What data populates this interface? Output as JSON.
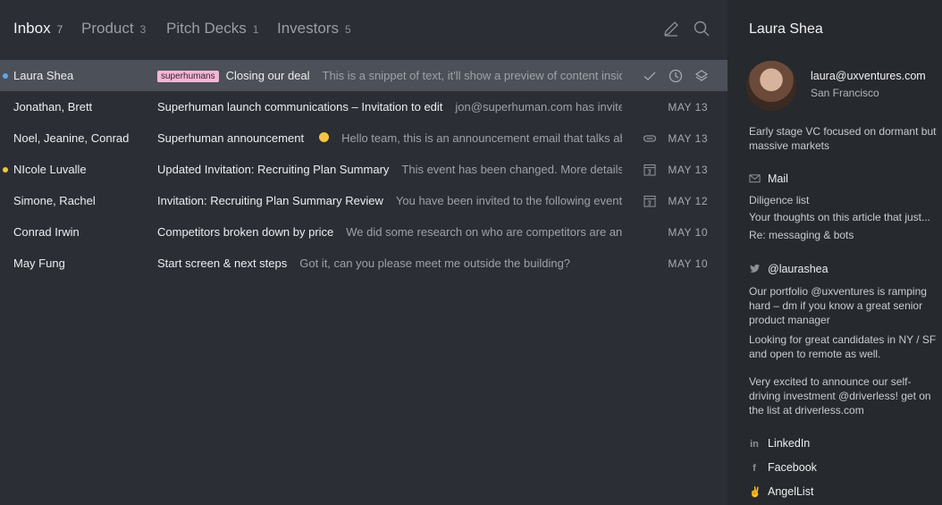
{
  "tabs": [
    {
      "label": "Inbox",
      "count": "7"
    },
    {
      "label": "Product",
      "count": "3"
    },
    {
      "label": "Pitch Decks",
      "count": "1"
    },
    {
      "label": "Investors",
      "count": "5"
    }
  ],
  "toolbar_icons": [
    "compose-icon",
    "search-icon"
  ],
  "emails": [
    {
      "sender": "Laura Shea",
      "tag": "superhumans",
      "subject": "Closing our deal",
      "snippet": "This is a snippet of text, it'll show a preview of content inside...",
      "date": "",
      "unread_color": "#5aa9e6"
    },
    {
      "sender": "Jonathan, Brett",
      "subject": "Superhuman launch communications – Invitation to edit",
      "snippet": "jon@superhuman.com has invite...",
      "date": "MAY 13"
    },
    {
      "sender": "Noel, Jeanine, Conrad",
      "subject": "Superhuman announcement",
      "snippet": "Hello team, this is an announcement email that talks about t...",
      "date": "MAY 13"
    },
    {
      "sender": "NIcole Luvalle",
      "subject": "Updated Invitation: Recruiting Plan Summary",
      "snippet": "This event has been changed. More details Rec...",
      "date": "MAY 13",
      "unread_color": "#f5c542"
    },
    {
      "sender": "Simone, Rachel",
      "subject": "Invitation: Recruiting Plan Summary Review",
      "snippet": "You have been invited to the following event. Mo...",
      "date": "MAY 12"
    },
    {
      "sender": "Conrad Irwin",
      "subject": "Competitors broken down by price",
      "snippet": "We did some research on who are competitors are and...",
      "date": "MAY 10"
    },
    {
      "sender": "May Fung",
      "subject": "Start screen & next steps",
      "snippet": "Got it, can you please meet me outside the building?",
      "date": "MAY 10"
    }
  ],
  "contact": {
    "name": "Laura Shea",
    "email": "laura@uxventures.com",
    "location": "San Francisco",
    "bio": "Early stage VC focused on dormant but massive markets",
    "mail_heading": "Mail",
    "mail_items": [
      "Diligence list",
      "Your thoughts on this article that just...",
      "Re: messaging & bots"
    ],
    "twitter_handle": "@laurashea",
    "tweets": [
      "Our portfolio @uxventures is ramping hard – dm if you know a great senior product manager",
      "Looking for great candidates in NY / SF and open to remote as well.",
      "Very excited to announce our self-driving investment @driverless! get on the list at driverless.com"
    ],
    "links": [
      "LinkedIn",
      "Facebook",
      "AngelList"
    ]
  },
  "colors": {
    "accent_tag": "#f2b7d6",
    "unread_blue": "#5aa9e6",
    "unread_yellow": "#f5c542"
  }
}
